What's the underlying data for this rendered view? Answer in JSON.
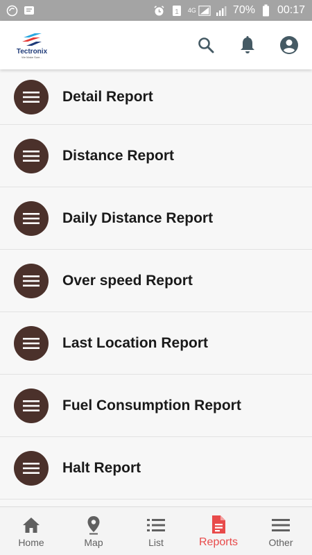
{
  "status_bar": {
    "network": "4G",
    "sim": "1",
    "battery": "70%",
    "time": "00:17"
  },
  "app_bar": {
    "logo_text": "Tectronix",
    "logo_tagline": "We Make Sure...",
    "icons": [
      "search-icon",
      "bell-icon",
      "account-icon"
    ]
  },
  "reports": [
    {
      "label": "Detail Report"
    },
    {
      "label": "Distance Report"
    },
    {
      "label": "Daily Distance Report"
    },
    {
      "label": "Over speed Report"
    },
    {
      "label": "Last Location Report"
    },
    {
      "label": "Fuel Consumption Report"
    },
    {
      "label": "Halt Report"
    }
  ],
  "bottom_nav": {
    "items": [
      {
        "label": "Home",
        "icon": "home-icon"
      },
      {
        "label": "Map",
        "icon": "map-pin-icon"
      },
      {
        "label": "List",
        "icon": "list-icon"
      },
      {
        "label": "Reports",
        "icon": "report-file-icon"
      },
      {
        "label": "Other",
        "icon": "menu-icon"
      }
    ],
    "active": "Reports"
  },
  "colors": {
    "status_bar": "#a4a4a4",
    "menu_circle": "#4b312b",
    "icon_gray": "#455a64",
    "active": "#e84a4a",
    "brand_blue": "#1e3a78",
    "brand_red": "#e53935",
    "brand_light_blue": "#29a8e0"
  }
}
